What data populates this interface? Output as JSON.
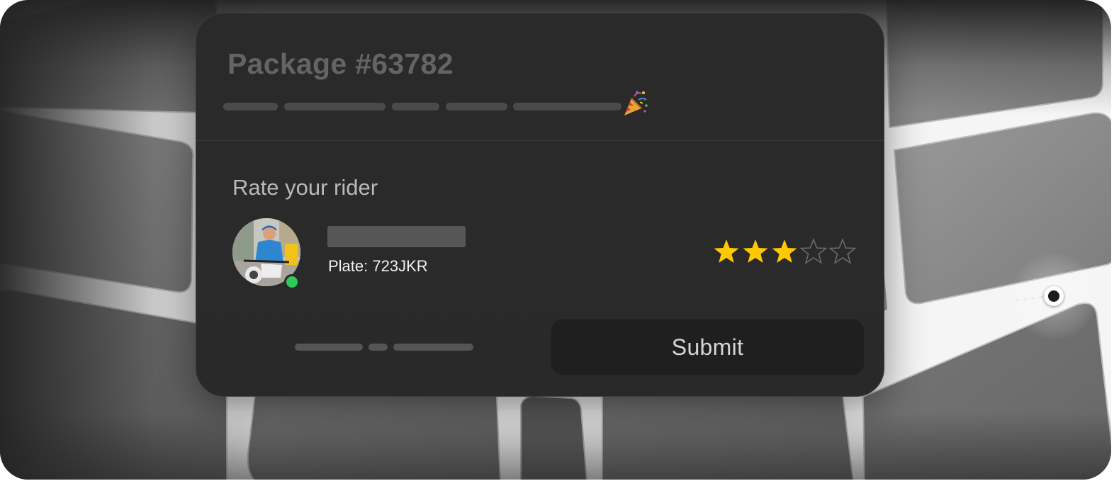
{
  "package": {
    "title": "Package #63782",
    "progress_complete": true,
    "celebration_icon": "party-popper-icon"
  },
  "rating": {
    "section_title": "Rate your rider",
    "rider": {
      "plate": "Plate: 723JKR",
      "online": true
    },
    "stars_selected": 3,
    "stars_total": 5,
    "star_filled_color": "#FFC800",
    "star_empty_color": "#6a6a6a"
  },
  "actions": {
    "submit_label": "Submit"
  },
  "map": {
    "current_location_icon": "location-dot-icon"
  }
}
